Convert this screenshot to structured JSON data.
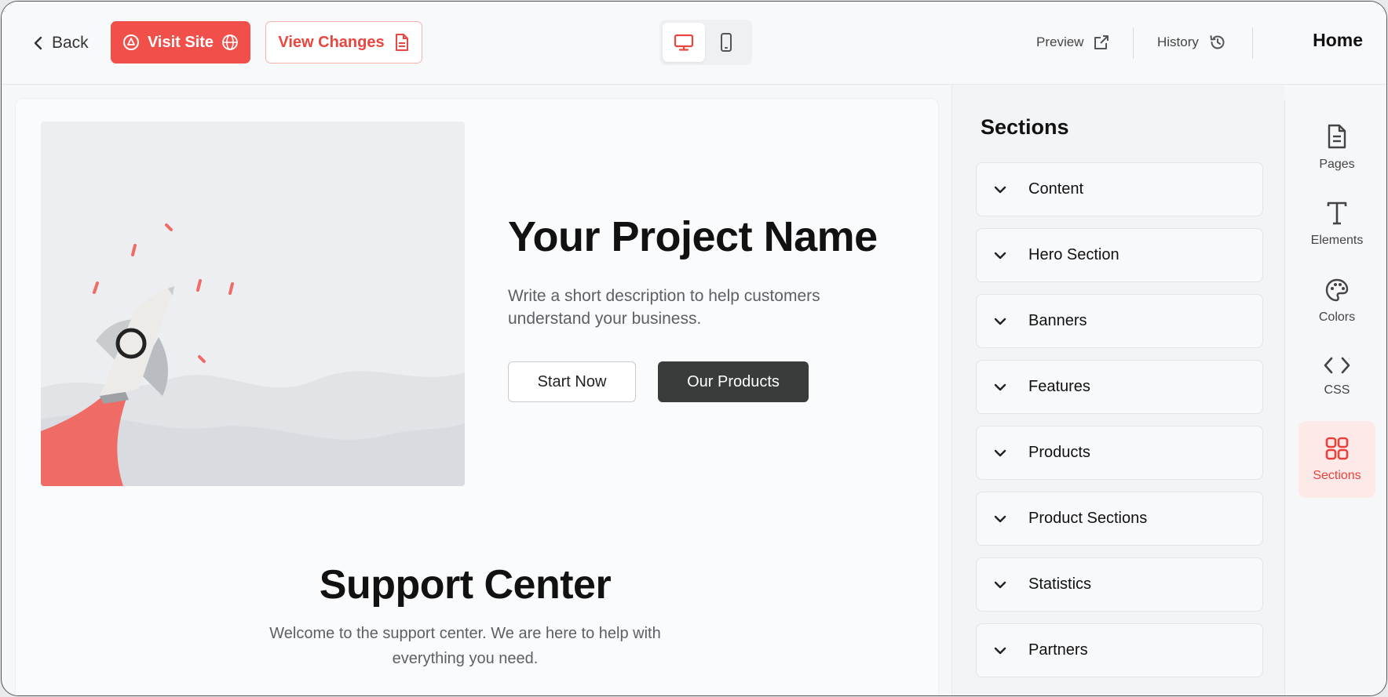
{
  "topbar": {
    "back_label": "Back",
    "visit_site_label": "Visit Site",
    "view_changes_label": "View Changes",
    "preview_label": "Preview",
    "history_label": "History",
    "page_label": "Home",
    "device_active": "desktop"
  },
  "canvas": {
    "hero_title": "Your Project Name",
    "hero_description": "Write a short description to help customers understand your business.",
    "start_button": "Start Now",
    "products_button": "Our Products",
    "support_title": "Support Center",
    "support_description": "Welcome to the support center. We are here to help with everything you need."
  },
  "panel": {
    "title": "Sections",
    "items": [
      {
        "label": "Content"
      },
      {
        "label": "Hero Section"
      },
      {
        "label": "Banners"
      },
      {
        "label": "Features"
      },
      {
        "label": "Products"
      },
      {
        "label": "Product Sections"
      },
      {
        "label": "Statistics"
      },
      {
        "label": "Partners"
      }
    ]
  },
  "rail": {
    "items": [
      {
        "label": "Pages",
        "icon": "document-icon"
      },
      {
        "label": "Elements",
        "icon": "text-icon"
      },
      {
        "label": "Colors",
        "icon": "palette-icon"
      },
      {
        "label": "CSS",
        "icon": "code-icon"
      },
      {
        "label": "Sections",
        "icon": "grid-icon",
        "active": true
      }
    ]
  },
  "colors": {
    "accent": "#f1504a",
    "dark_button": "#383d3c",
    "active_rail_bg": "#fde9e8"
  }
}
